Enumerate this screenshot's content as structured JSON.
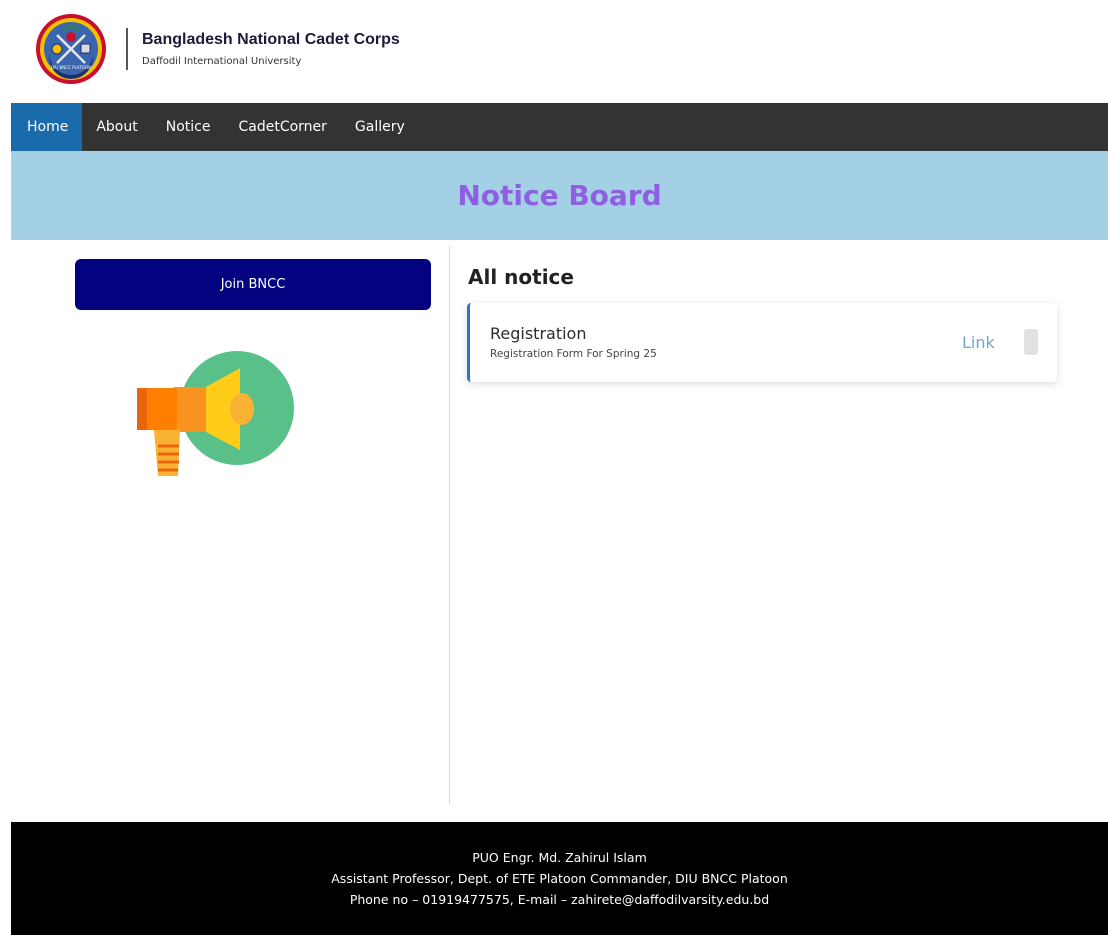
{
  "header": {
    "logo_icon": "bncc-diu-platoon-logo",
    "logo_text": "DIU BNCC PLATOON",
    "title": "Bangladesh National Cadet Corps",
    "subtitle": "Daffodil International University"
  },
  "nav": {
    "items": [
      {
        "label": "Home",
        "active": true
      },
      {
        "label": "About",
        "active": false
      },
      {
        "label": "Notice",
        "active": false
      },
      {
        "label": "CadetCorner",
        "active": false
      },
      {
        "label": "Gallery",
        "active": false
      }
    ]
  },
  "banner": {
    "title": "Notice Board"
  },
  "sidebar": {
    "join_label": "Join BNCC",
    "illustration_icon": "megaphone-icon"
  },
  "notices": {
    "section_title": "All notice",
    "items": [
      {
        "title": "Registration",
        "description": "Registration Form For Spring 25",
        "link_label": "Link"
      }
    ]
  },
  "footer": {
    "line1": "PUO Engr. Md. Zahirul Islam",
    "line2": "Assistant Professor, Dept. of ETE Platoon Commander, DIU BNCC Platoon",
    "line3": "Phone no – 01919477575, E-mail – zahirete@daffodilvarsity.edu.bd"
  },
  "colors": {
    "navbar": "#333333",
    "nav_active": "#1a6bac",
    "banner_bg": "#a3d0e4",
    "banner_title": "#8e5fe0",
    "join_button": "#03037f",
    "notice_accent": "#2a77c9",
    "link": "#6fa6d8",
    "footer": "#000000"
  }
}
